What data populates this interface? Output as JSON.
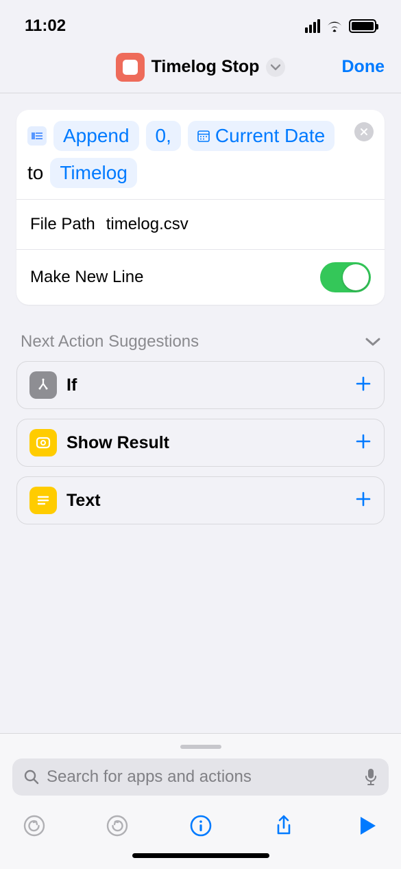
{
  "status": {
    "time": "11:02"
  },
  "header": {
    "title": "Timelog Stop",
    "done": "Done"
  },
  "action": {
    "verb": "Append",
    "text_value": "0,",
    "variable": "Current Date",
    "joiner": "to",
    "target": "Timelog",
    "params": {
      "file_path_label": "File Path",
      "file_path_value": "timelog.csv",
      "new_line_label": "Make New Line",
      "new_line_on": true
    }
  },
  "suggestions": {
    "heading": "Next Action Suggestions",
    "items": [
      {
        "label": "If",
        "icon": "branch",
        "color": "gray"
      },
      {
        "label": "Show Result",
        "icon": "result",
        "color": "yellow"
      },
      {
        "label": "Text",
        "icon": "text",
        "color": "yellow"
      }
    ]
  },
  "search": {
    "placeholder": "Search for apps and actions"
  }
}
